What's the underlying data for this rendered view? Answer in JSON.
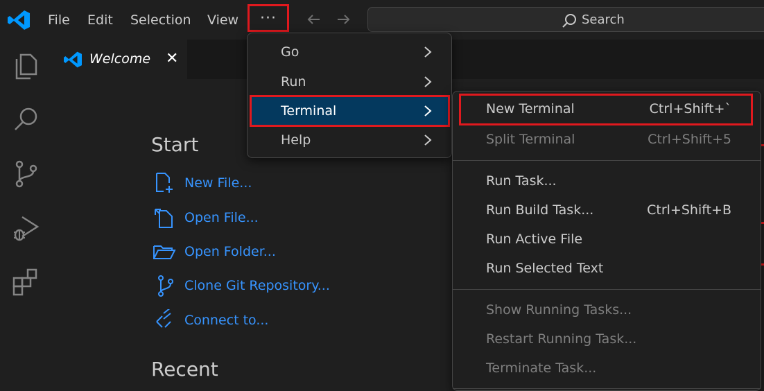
{
  "titlebar": {
    "menus": [
      "File",
      "Edit",
      "Selection",
      "View"
    ],
    "more_label": "···",
    "search": {
      "label": "Search"
    }
  },
  "activity_icons": [
    "files-icon",
    "search-icon",
    "source-control-icon",
    "run-debug-icon",
    "extensions-icon"
  ],
  "tab": {
    "label": "Welcome",
    "close": "✕"
  },
  "welcome": {
    "start_heading": "Start",
    "links": [
      "New File...",
      "Open File...",
      "Open Folder...",
      "Clone Git Repository...",
      "Connect to..."
    ],
    "recent_heading": "Recent"
  },
  "more_menu": {
    "items": [
      "Go",
      "Run",
      "Terminal",
      "Help"
    ],
    "active_index": 2
  },
  "terminal_menu": {
    "groups": [
      [
        {
          "label": "New Terminal",
          "shortcut": "Ctrl+Shift+`",
          "enabled": true
        },
        {
          "label": "Split Terminal",
          "shortcut": "Ctrl+Shift+5",
          "enabled": false
        }
      ],
      [
        {
          "label": "Run Task...",
          "shortcut": "",
          "enabled": true
        },
        {
          "label": "Run Build Task...",
          "shortcut": "Ctrl+Shift+B",
          "enabled": true
        },
        {
          "label": "Run Active File",
          "shortcut": "",
          "enabled": true
        },
        {
          "label": "Run Selected Text",
          "shortcut": "",
          "enabled": true
        }
      ],
      [
        {
          "label": "Show Running Tasks...",
          "shortcut": "",
          "enabled": false
        },
        {
          "label": "Restart Running Task...",
          "shortcut": "",
          "enabled": false
        },
        {
          "label": "Terminate Task...",
          "shortcut": "",
          "enabled": false
        }
      ]
    ]
  },
  "colors": {
    "accent_link": "#3794ff",
    "highlight_box": "#e0191e",
    "selected_item": "#04395e",
    "vscode_blue": "#0098ff"
  }
}
